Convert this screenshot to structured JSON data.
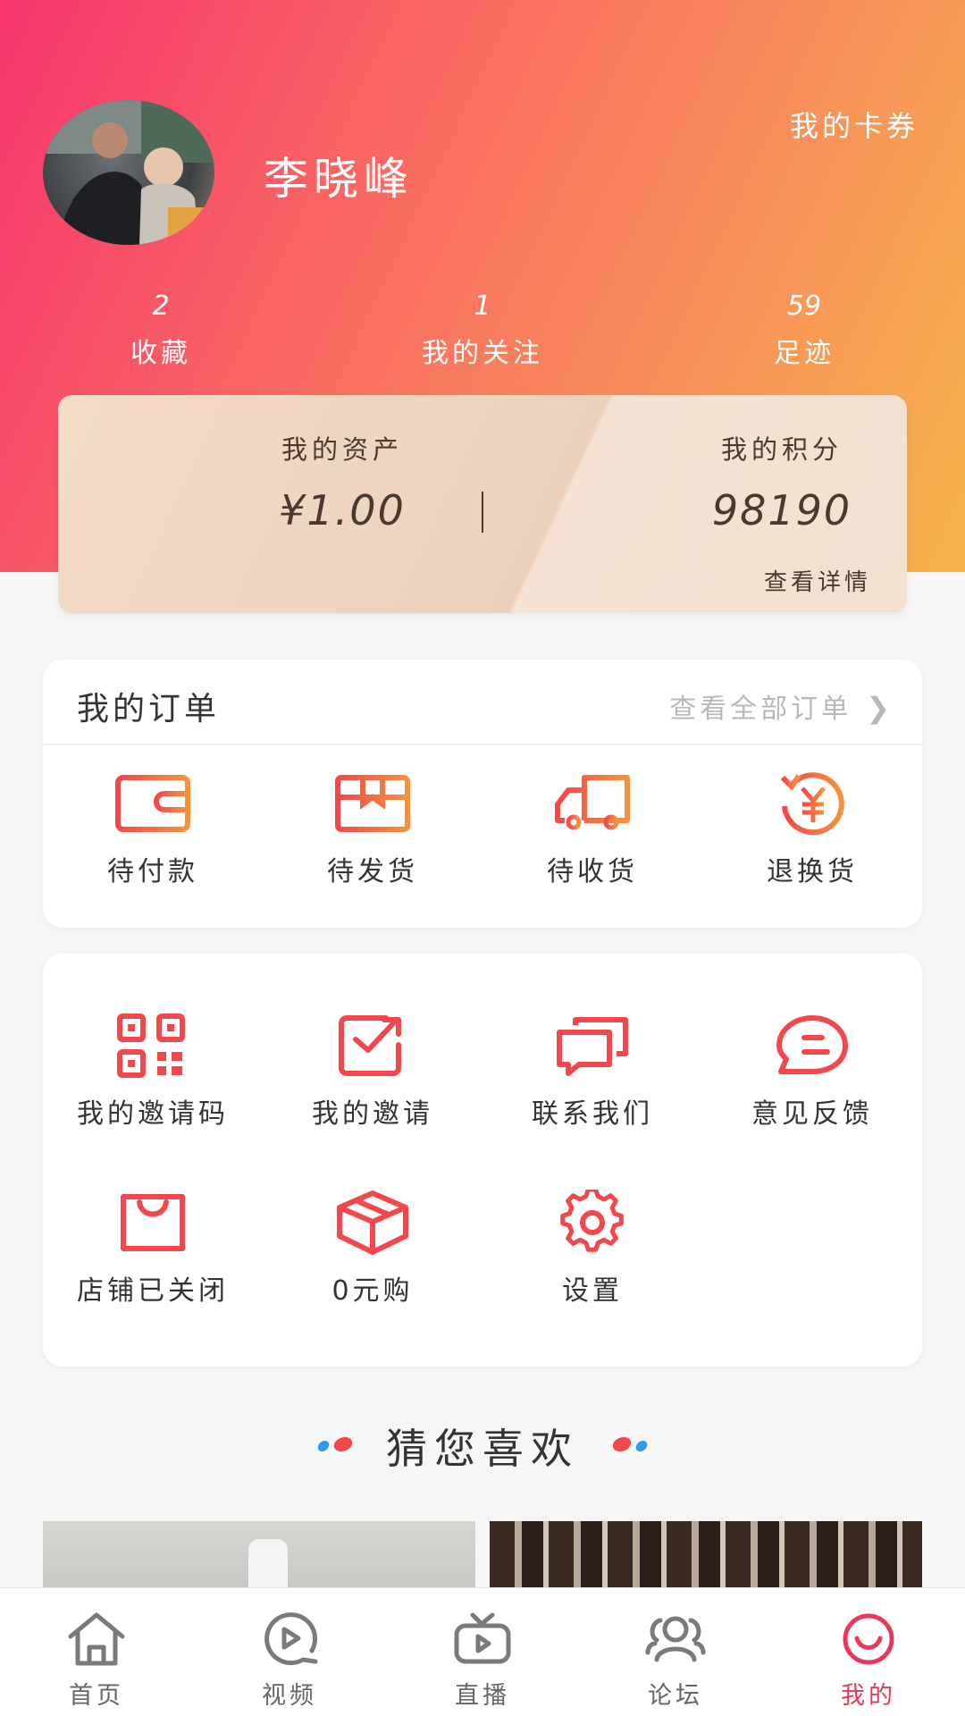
{
  "header": {
    "user_name": "李晓峰",
    "coupon_link": "我的卡券",
    "stats": [
      {
        "value": "2",
        "label": "收藏"
      },
      {
        "value": "1",
        "label": "我的关注"
      },
      {
        "value": "59",
        "label": "足迹"
      }
    ]
  },
  "assets": {
    "balance_title": "我的资产",
    "balance_value": "¥1.00",
    "points_title": "我的积分",
    "points_value": "98190",
    "detail_link": "查看详情"
  },
  "orders": {
    "title": "我的订单",
    "view_all": "查看全部订单",
    "items": [
      {
        "label": "待付款",
        "icon": "wallet-icon"
      },
      {
        "label": "待发货",
        "icon": "package-icon"
      },
      {
        "label": "待收货",
        "icon": "truck-icon"
      },
      {
        "label": "退换货",
        "icon": "refund-yuan-icon"
      }
    ]
  },
  "tools": {
    "items": [
      {
        "label": "我的邀请码",
        "icon": "qr-code-icon"
      },
      {
        "label": "我的邀请",
        "icon": "share-invite-icon"
      },
      {
        "label": "联系我们",
        "icon": "chat-windows-icon"
      },
      {
        "label": "意见反馈",
        "icon": "feedback-bubble-icon"
      },
      {
        "label": "店铺已关闭",
        "icon": "shop-bag-icon"
      },
      {
        "label": "0元购",
        "icon": "box-icon"
      },
      {
        "label": "设置",
        "icon": "gear-icon"
      }
    ]
  },
  "recommend": {
    "title": "猜您喜欢"
  },
  "tabbar": {
    "tabs": [
      {
        "label": "首页",
        "icon": "home-icon"
      },
      {
        "label": "视频",
        "icon": "video-play-icon"
      },
      {
        "label": "直播",
        "icon": "live-tv-icon"
      },
      {
        "label": "论坛",
        "icon": "forum-users-icon"
      },
      {
        "label": "我的",
        "icon": "smile-profile-icon",
        "active": true
      }
    ]
  },
  "colors": {
    "accent": "#e8385b",
    "icon_red": "#f2484b",
    "icon_orange": "#f7923a",
    "header_start": "#f6356d",
    "header_end": "#f7b54a"
  }
}
